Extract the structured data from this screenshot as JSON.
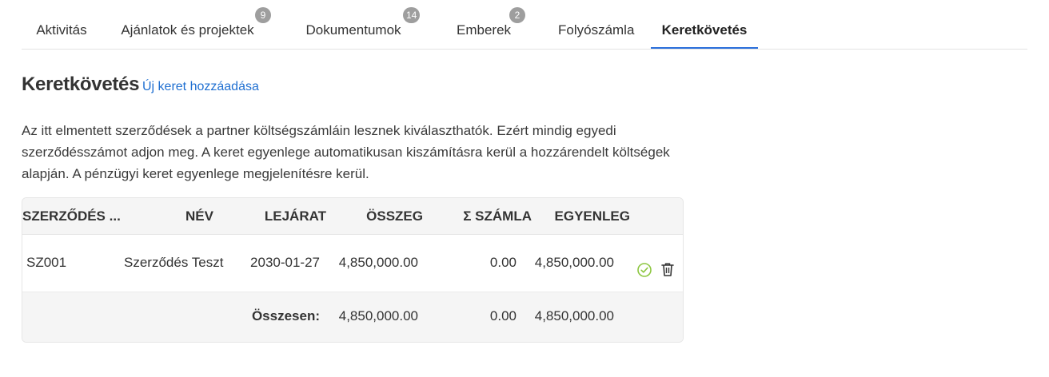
{
  "tabs": [
    {
      "label": "Aktivitás"
    },
    {
      "label": "Ajánlatok és projektek",
      "badge": "9"
    },
    {
      "label": "Dokumentumok",
      "badge": "14"
    },
    {
      "label": "Emberek",
      "badge": "2"
    },
    {
      "label": "Folyószámla"
    },
    {
      "label": "Keretkövetés",
      "active": true
    }
  ],
  "page": {
    "title": "Keretkövetés",
    "add_link": "Új keret hozzáadása",
    "description": "Az itt elmentett szerződések a partner költségszámláin lesznek kiválaszthatók. Ezért mindig egyedi szerződésszámot adjon meg. A keret egyenlege automatikusan kiszámításra kerül a hozzárendelt költségek alapján. A pénzügyi keret egyenlege megjelenítésre kerül."
  },
  "table": {
    "headers": {
      "contract_no": "SZERZŐDÉS ...",
      "name": "NÉV",
      "expiry": "LEJÁRAT",
      "amount": "ÖSSZEG",
      "invoiced": "Σ SZÁMLA",
      "balance": "EGYENLEG"
    },
    "rows": [
      {
        "contract_no": "SZ001",
        "name": "Szerződés Teszt",
        "expiry": "2030-01-27",
        "amount": "4,850,000.00",
        "invoiced": "0.00",
        "balance": "4,850,000.00",
        "icons": [
          "check-circle-icon",
          "trash-icon"
        ]
      }
    ],
    "footer": {
      "label": "Összesen:",
      "amount": "4,850,000.00",
      "invoiced": "0.00",
      "balance": "4,850,000.00"
    }
  },
  "colors": {
    "accent": "#2a6fdb",
    "link": "#1f6fd1",
    "badge": "#9e9e9e",
    "check": "#8cc63f"
  }
}
